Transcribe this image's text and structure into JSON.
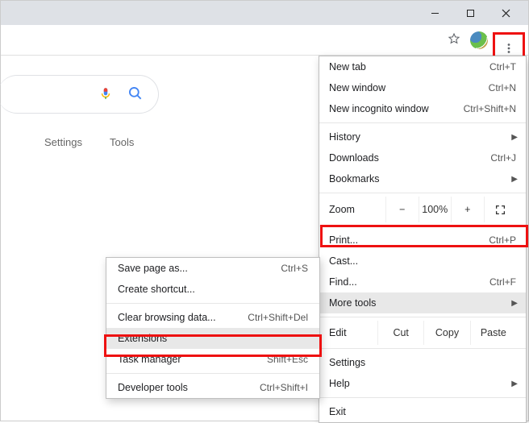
{
  "page": {
    "links": {
      "settings": "Settings",
      "tools": "Tools"
    }
  },
  "menu": {
    "new_tab": "New tab",
    "new_tab_sc": "Ctrl+T",
    "new_window": "New window",
    "new_window_sc": "Ctrl+N",
    "new_incognito": "New incognito window",
    "new_incognito_sc": "Ctrl+Shift+N",
    "history": "History",
    "downloads": "Downloads",
    "downloads_sc": "Ctrl+J",
    "bookmarks": "Bookmarks",
    "zoom_label": "Zoom",
    "zoom_minus": "−",
    "zoom_value": "100%",
    "zoom_plus": "+",
    "print": "Print...",
    "print_sc": "Ctrl+P",
    "cast": "Cast...",
    "find": "Find...",
    "find_sc": "Ctrl+F",
    "more_tools": "More tools",
    "edit_label": "Edit",
    "cut": "Cut",
    "copy": "Copy",
    "paste": "Paste",
    "settings": "Settings",
    "help": "Help",
    "exit": "Exit"
  },
  "submenu": {
    "save_page": "Save page as...",
    "save_page_sc": "Ctrl+S",
    "create_shortcut": "Create shortcut...",
    "clear_data": "Clear browsing data...",
    "clear_data_sc": "Ctrl+Shift+Del",
    "extensions": "Extensions",
    "task_manager": "Task manager",
    "task_manager_sc": "Shift+Esc",
    "dev_tools": "Developer tools",
    "dev_tools_sc": "Ctrl+Shift+I"
  }
}
